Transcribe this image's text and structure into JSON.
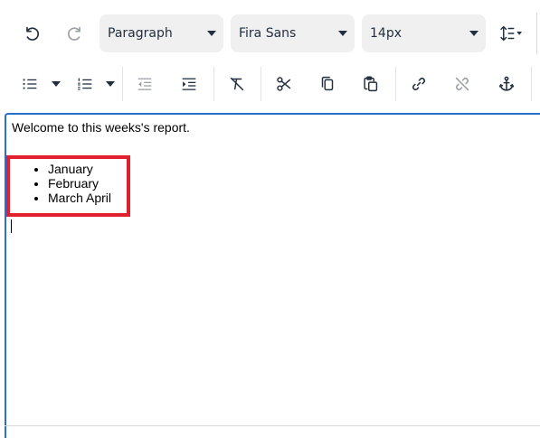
{
  "toolbar": {
    "block_format": {
      "value": "Paragraph"
    },
    "font_family": {
      "value": "Fira Sans"
    },
    "font_size": {
      "value": "14px"
    }
  },
  "icons": {
    "undo": "undo-icon",
    "redo": "redo-icon",
    "line_height": "line-height-icon",
    "bullet_list": "bullet-list-icon",
    "numbered_list": "numbered-list-icon",
    "outdent": "outdent-icon",
    "indent": "indent-icon",
    "clear_formatting": "clear-formatting-icon",
    "cut": "cut-icon",
    "copy": "copy-icon",
    "paste": "paste-icon",
    "link": "link-icon",
    "unlink": "unlink-icon",
    "anchor": "anchor-icon"
  },
  "editor": {
    "intro": "Welcome to this weeks's report.",
    "list_items": [
      "January",
      "February",
      "March April"
    ]
  },
  "colors": {
    "focus_border": "#2a6ed2",
    "highlight_box": "#e0202d",
    "select_bg": "#f0f0f0",
    "icon": "#222f3e"
  }
}
